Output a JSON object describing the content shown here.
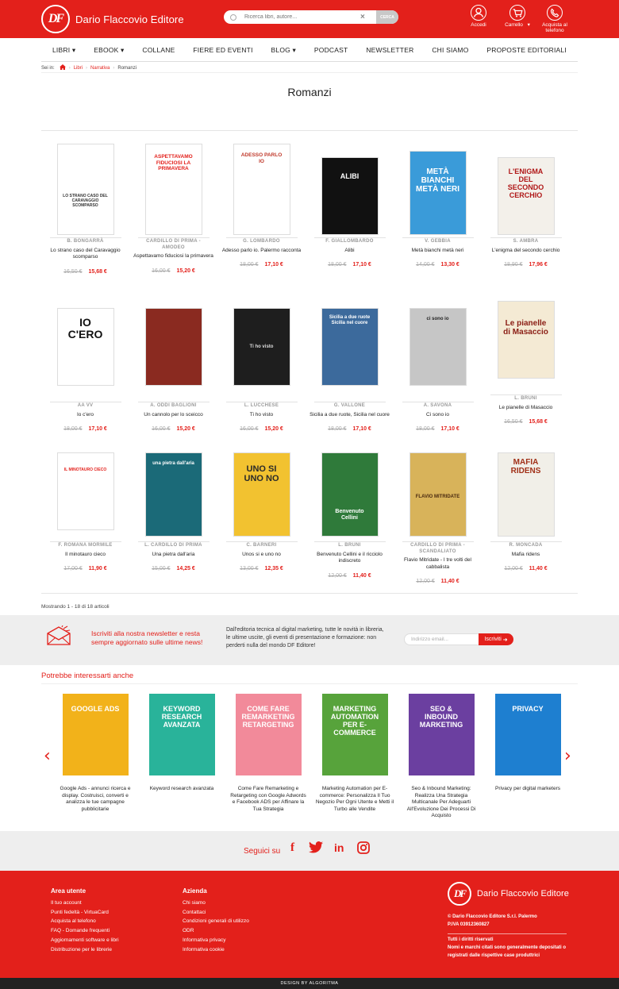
{
  "header": {
    "brand": "Dario Flaccovio Editore",
    "logo_mark": "DF",
    "search_placeholder": "Ricerca libri, autore...",
    "search_button": "CERCA",
    "icons": [
      {
        "label": "Accedi",
        "icon": "user-icon"
      },
      {
        "label": "Carrello",
        "icon": "cart-icon"
      },
      {
        "label": "Acquista al telefono",
        "icon": "phone-icon"
      }
    ],
    "colors": {
      "brand": "#e3201b"
    }
  },
  "nav": [
    "LIBRI",
    "EBOOK",
    "COLLANE",
    "FIERE ED EVENTI",
    "BLOG",
    "PODCAST",
    "NEWSLETTER",
    "CHI SIAMO",
    "PROPOSTE EDITORIALI"
  ],
  "breadcrumb": {
    "prefix": "Sei in:",
    "items": [
      "Libri",
      "Narrativa",
      "Romanzi"
    ]
  },
  "page_title": "Romanzi",
  "products": [
    {
      "author": "B. BONGARRÀ",
      "title": "Lo strano caso del Caravaggio scomparso",
      "old": "16,50 €",
      "new": "15,68 €",
      "cover_text": "LO STRANO CASO DEL CARAVAGGIO SCOMPARSO"
    },
    {
      "author": "CARDILLO DI PRIMA - AMODEO",
      "title": "Aspettavamo fiduciosi la primavera",
      "old": "16,00 €",
      "new": "15,20 €",
      "cover_text": "ASPETTAVAMO FIDUCIOSI LA PRIMAVERA"
    },
    {
      "author": "G. LOMBARDO",
      "title": "Adesso parlo io. Palermo racconta",
      "old": "18,00 €",
      "new": "17,10 €",
      "cover_text": "ADESSO PARLO IO"
    },
    {
      "author": "F. GIALLOMBARDO",
      "title": "Alibi",
      "old": "18,00 €",
      "new": "17,10 €",
      "cover_text": "ALIBI"
    },
    {
      "author": "V. GEBBIA",
      "title": "Metà bianchi metà neri",
      "old": "14,00 €",
      "new": "13,30 €",
      "cover_text": "METÀ BIANCHI METÀ NERI"
    },
    {
      "author": "S. AMBRA",
      "title": "L'enigma del secondo cerchio",
      "old": "18,90 €",
      "new": "17,96 €",
      "cover_text": "L'ENIGMA DEL SECONDO CERCHIO"
    },
    {
      "author": "AA VV",
      "title": "Io c'ero",
      "old": "18,00 €",
      "new": "17,10 €",
      "cover_text": "IO C'ERO"
    },
    {
      "author": "A. ODDI BAGLIONI",
      "title": "Un cannolo per lo sceicco",
      "old": "16,00 €",
      "new": "15,20 €",
      "cover_text": ""
    },
    {
      "author": "L. LUCCHESE",
      "title": "Ti ho visto",
      "old": "16,00 €",
      "new": "15,20 €",
      "cover_text": "Ti ho visto"
    },
    {
      "author": "G. VALLONE",
      "title": "Sicilia a due ruote, Sicilia nel cuore",
      "old": "18,00 €",
      "new": "17,10 €",
      "cover_text": "Sicilia a due ruote Sicilia nel cuore"
    },
    {
      "author": "A. SAVONA",
      "title": "Ci sono io",
      "old": "18,00 €",
      "new": "17,10 €",
      "cover_text": "ci sono io"
    },
    {
      "author": "L. BRUNI",
      "title": "Le pianelle di Masaccio",
      "old": "16,50 €",
      "new": "15,68 €",
      "cover_text": "Le pianelle di Masaccio"
    },
    {
      "author": "F. ROMANA MORMILE",
      "title": "Il minotauro cieco",
      "old": "17,00 €",
      "new": "11,90 €",
      "cover_text": "IL MINOTAURO CIECO"
    },
    {
      "author": "L. CARDILLO DI PRIMA",
      "title": "Una pietra dall'aria",
      "old": "15,00 €",
      "new": "14,25 €",
      "cover_text": "una pietra dall'aria"
    },
    {
      "author": "C. BARNERI",
      "title": "Unos si e uno no",
      "old": "13,00 €",
      "new": "12,35 €",
      "cover_text": "UNO SI UNO NO"
    },
    {
      "author": "L. BRUNI",
      "title": "Benvenuto Cellini e il ricciolo indiscreto",
      "old": "12,00 €",
      "new": "11,40 €",
      "cover_text": "Benvenuto Cellini"
    },
    {
      "author": "CARDILLO DI PRIMA - SCANDALIATO",
      "title": "Flavio Mitridate - I tre volti del cabbalista",
      "old": "12,00 €",
      "new": "11,40 €",
      "cover_text": "FLAVIO MITRIDATE"
    },
    {
      "author": "R. MONCADA",
      "title": "Mafia ridens",
      "old": "12,00 €",
      "new": "11,40 €",
      "cover_text": "MAFIA RIDENS"
    }
  ],
  "showing": "Mostrando 1 - 18 di 18 articoli",
  "newsletter": {
    "headline": "Iscriviti alla nostra newsletter e resta sempre aggiornato sulle ultime news!",
    "description": "Dall'editoria tecnica al digital marketing, tutte le novità in libreria, le ultime uscite, gli eventi di presentazione e formazione: non perderti nulla del mondo DF Editore!",
    "placeholder": "Indirizzo email...",
    "button": "Iscriviti"
  },
  "related": {
    "heading": "Potrebbe interessarti anche",
    "items": [
      {
        "title": "Google Ads - annunci ricerca e display. Costruisci, converti e analizza le tue campagne pubblicitarie",
        "cover_text": "GOOGLE ADS",
        "bg": "#f2b21a"
      },
      {
        "title": "Keyword research avanzata",
        "cover_text": "KEYWORD RESEARCH AVANZATA",
        "bg": "#29b39a"
      },
      {
        "title": "Come Fare Remarketing e Retargeting con Google Adwords e Facebook ADS per Affinare la Tua Strategia",
        "cover_text": "COME FARE REMARKETING RETARGETING",
        "bg": "#f28a9a"
      },
      {
        "title": "Marketing Automation per E-commerce: Personalizza Il Tuo Negozio Per Ogni Utente e Metti il Turbo alle Vendite",
        "cover_text": "MARKETING AUTOMATION PER E-COMMERCE",
        "bg": "#57a33b"
      },
      {
        "title": "Seo & Inbound Marketing: Realizza Una Strategia Multicanale Per Adeguarti All'Evoluzione Dei Processi Di Acquisto",
        "cover_text": "SEO & INBOUND MARKETING",
        "bg": "#6b3fa0"
      },
      {
        "title": "Privacy per digital marketers",
        "cover_text": "PRIVACY",
        "bg": "#1e7fd0"
      }
    ]
  },
  "social": {
    "label": "Seguici su",
    "networks": [
      "facebook-icon",
      "twitter-icon",
      "linkedin-icon",
      "instagram-icon"
    ]
  },
  "footer": {
    "col1": {
      "heading": "Area utente",
      "links": [
        "Il tuo account",
        "Punti fedeltà - VirtuaCard",
        "Acquista al telefono",
        "FAQ - Domande frequenti",
        "Aggiornamenti software e libri",
        "Distribuzione per le librerie"
      ]
    },
    "col2": {
      "heading": "Azienda",
      "links": [
        "Chi siamo",
        "Contattaci",
        "Condizioni generali di utilizzo",
        "ODR",
        "Informativa privacy",
        "Informativa cookie"
      ]
    },
    "company": "© Dario Flaccovio Editore S.r.l. Palermo",
    "vat": "P.IVA 03912360827",
    "rights": "Tutti i diritti riservati",
    "trademark": "Nomi e marchi citati sono generalmente depositati o registrati dalle rispettive case produttrici"
  },
  "bottom_bar": "DESIGN BY ALGORITMA"
}
